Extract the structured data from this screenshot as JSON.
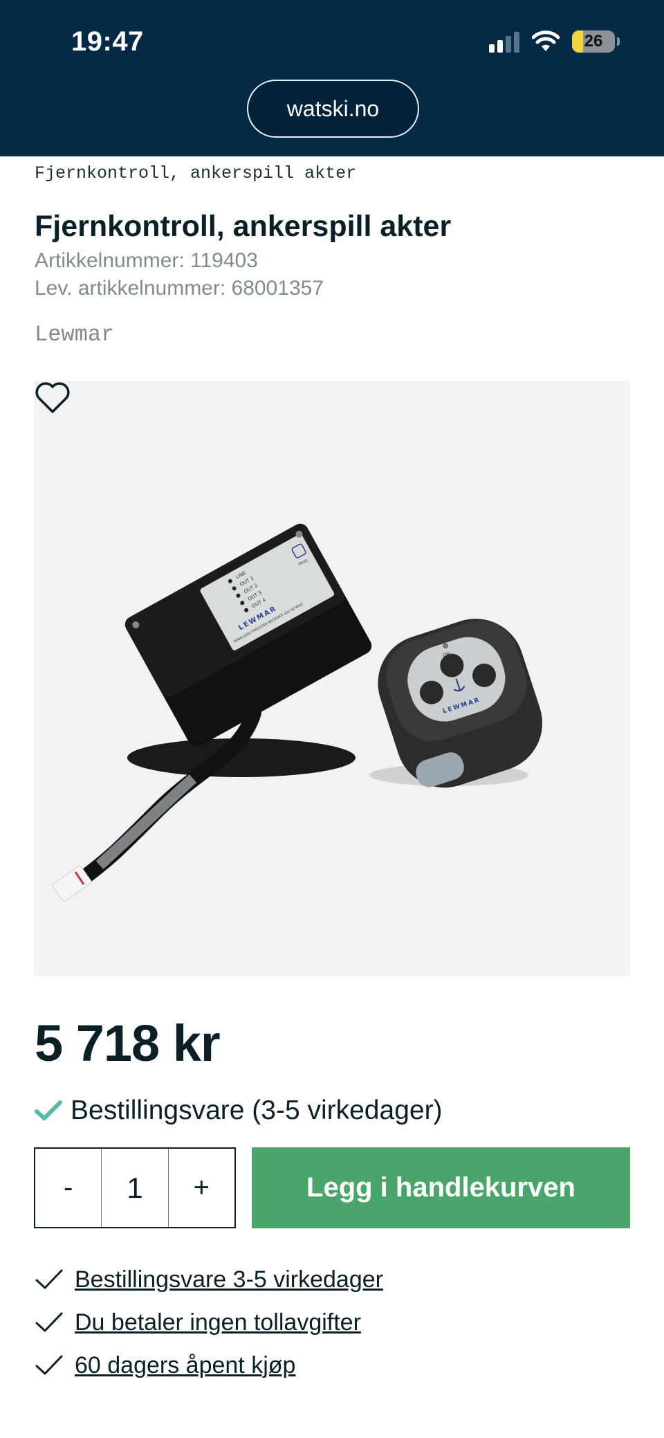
{
  "status_bar": {
    "time": "19:47",
    "battery_level": "26",
    "icons": [
      "signal-icon",
      "wifi-icon",
      "battery-icon"
    ]
  },
  "browser": {
    "url": "watski.no"
  },
  "breadcrumb": "Fjernkontroll, ankerspill akter",
  "product": {
    "title": "Fjernkontroll, ankerspill akter",
    "article_number": "Artikkelnummer: 119403",
    "supplier_article_number": "Lev. artikkelnummer: 68001357",
    "brand": "Lewmar",
    "image_labels": {
      "logo": "LEWMAR",
      "line": "LINE",
      "out1": "OUT 1",
      "out2": "OUT 2",
      "out3": "OUT 3",
      "out4": "OUT 4",
      "receiver": "WINDLASS/THRUSTER RECEIVER 433.92 MHZ",
      "prog": "PROG",
      "on": "ON"
    },
    "favorite_icon": "heart-icon",
    "price": "5 718 kr",
    "availability": "Bestillingsvare (3-5 virkedager)",
    "availability_color": "#57b8ad",
    "quantity": {
      "decrement": "-",
      "value": "1",
      "increment": "+"
    },
    "add_to_cart": "Legg i handlekurven",
    "cart_button_color": "#4aa56a"
  },
  "benefits": [
    {
      "label": "Bestillingsvare 3-5 virkedager",
      "icon": "check-icon"
    },
    {
      "label": "Du betaler ingen tollavgifter",
      "icon": "check-icon"
    },
    {
      "label": "60 dagers åpent kjøp",
      "icon": "check-icon"
    }
  ],
  "colors": {
    "header_bg": "#052a45",
    "text": "#0b1f29",
    "muted": "#7e8b91"
  }
}
